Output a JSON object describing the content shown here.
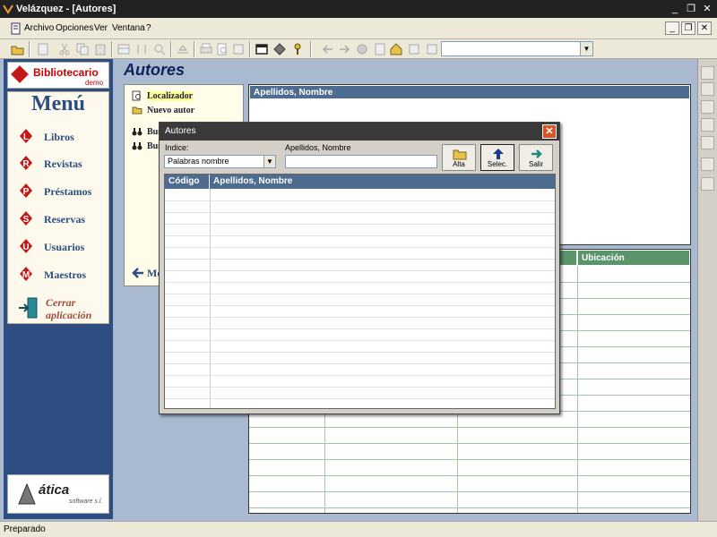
{
  "window": {
    "title": "Velázquez - [Autores]"
  },
  "menubar": {
    "items": [
      {
        "label": "Archivo",
        "key": "A"
      },
      {
        "label": "Opciones",
        "key": "O"
      },
      {
        "label": "Ver",
        "key": "V"
      },
      {
        "label": "Ventana",
        "key": "e"
      },
      {
        "label": "?",
        "key": "?"
      }
    ]
  },
  "toolbar": {
    "icons": [
      "open-icon",
      "cut-icon",
      "copy-icon",
      "paste-icon",
      "print-icon",
      "print-preview-icon",
      "find-icon",
      "export-icon",
      "back-icon",
      "forward-icon",
      "stop-icon",
      "refresh-icon",
      "home-icon",
      "help-icon"
    ],
    "combo_value": ""
  },
  "sidebar": {
    "logo_text": "Bibliotecario",
    "logo_sub": "demo",
    "menu_title": "Menú",
    "items": [
      {
        "label": "Libros",
        "letter": "L"
      },
      {
        "label": "Revistas",
        "letter": "R"
      },
      {
        "label": "Préstamos",
        "letter": "P"
      },
      {
        "label": "Reservas",
        "letter": "S"
      },
      {
        "label": "Usuarios",
        "letter": "U"
      },
      {
        "label": "Maestros",
        "letter": "M"
      }
    ],
    "close_label_1": "Cerrar",
    "close_label_2": "aplicación",
    "brand": "ática",
    "brand_sub": "software s.l."
  },
  "page": {
    "title": "Autores"
  },
  "locator_panel": {
    "items": [
      {
        "label": "Localizador"
      },
      {
        "label": "Nuevo autor"
      },
      {
        "label": "Bus"
      },
      {
        "label": "Bus"
      }
    ],
    "back_label": "Me"
  },
  "table1": {
    "header": "Apellidos, Nombre"
  },
  "table2": {
    "header_ubicacion": "Ubicación"
  },
  "dialog": {
    "title": "Autores",
    "indice_label": "Indice:",
    "indice_value": "Palabras nombre",
    "search_label": "Apellidos, Nombre",
    "search_value": "",
    "buttons": {
      "alta": "Alta",
      "selec": "Selec.",
      "salir": "Salir"
    },
    "grid_columns": [
      "Código",
      "Apellidos, Nombre"
    ]
  },
  "statusbar": {
    "text": "Preparado"
  },
  "colors": {
    "client_bg": "#a9bad0",
    "header_blue": "#4d6c8f",
    "header_green": "#5a946b",
    "sidebar_blue": "#2e4d80"
  }
}
